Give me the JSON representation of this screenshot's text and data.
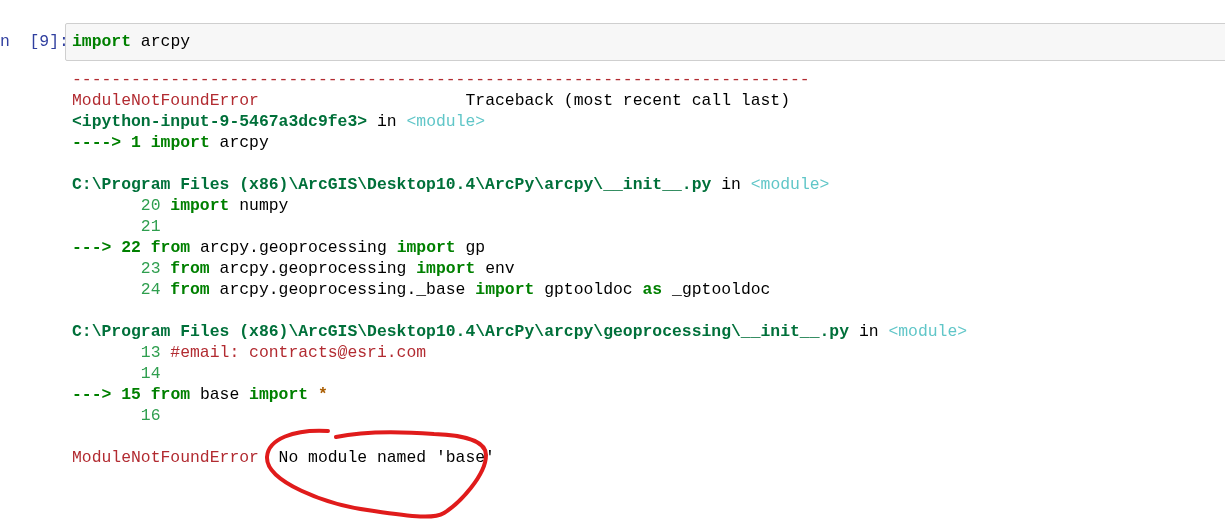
{
  "input_cell": {
    "prompt": "n  [9]:",
    "code": [
      {
        "t": "import",
        "kind": "kw"
      },
      {
        "t": " arcpy",
        "kind": "plain"
      }
    ]
  },
  "output_lines": [
    {
      "kind": "code",
      "tokens": [
        {
          "t": "---------------------------------------------------------------------------",
          "kind": "err"
        }
      ]
    },
    {
      "kind": "code",
      "tokens": [
        {
          "t": "ModuleNotFoundError                     ",
          "kind": "err"
        },
        {
          "t": "Traceback (most recent call last)",
          "kind": "plain"
        }
      ]
    },
    {
      "kind": "code",
      "tokens": [
        {
          "t": "<ipython-input-9-5467a3dc9fe3>",
          "kind": "path"
        },
        {
          "t": " in ",
          "kind": "plain"
        },
        {
          "t": "<module>",
          "kind": "cyan"
        }
      ]
    },
    {
      "kind": "code",
      "tokens": [
        {
          "t": "----> 1 ",
          "kind": "arrow"
        },
        {
          "t": "import",
          "kind": "kw"
        },
        {
          "t": " arcpy",
          "kind": "plain"
        }
      ]
    },
    {
      "kind": "blank"
    },
    {
      "kind": "code",
      "tokens": [
        {
          "t": "C:\\Program Files (x86)\\ArcGIS\\Desktop10.4\\ArcPy\\arcpy\\__init__.py",
          "kind": "path"
        },
        {
          "t": " in ",
          "kind": "plain"
        },
        {
          "t": "<module>",
          "kind": "cyan"
        }
      ]
    },
    {
      "kind": "code",
      "tokens": [
        {
          "t": "20 ",
          "kind": "lineno"
        },
        {
          "t": "import",
          "kind": "kw"
        },
        {
          "t": " numpy",
          "kind": "plain"
        }
      ]
    },
    {
      "kind": "code",
      "tokens": [
        {
          "t": "21",
          "kind": "lineno"
        }
      ]
    },
    {
      "kind": "code",
      "tokens": [
        {
          "t": "---> 22 ",
          "kind": "arrow"
        },
        {
          "t": "from",
          "kind": "kw"
        },
        {
          "t": " arcpy.geoprocessing ",
          "kind": "plain"
        },
        {
          "t": "import",
          "kind": "kw"
        },
        {
          "t": " gp",
          "kind": "plain"
        }
      ]
    },
    {
      "kind": "code",
      "tokens": [
        {
          "t": "23 ",
          "kind": "lineno"
        },
        {
          "t": "from",
          "kind": "kw"
        },
        {
          "t": " arcpy.geoprocessing ",
          "kind": "plain"
        },
        {
          "t": "import",
          "kind": "kw"
        },
        {
          "t": " env",
          "kind": "plain"
        }
      ]
    },
    {
      "kind": "code",
      "tokens": [
        {
          "t": "24 ",
          "kind": "lineno"
        },
        {
          "t": "from",
          "kind": "kw"
        },
        {
          "t": " arcpy.geoprocessing._base ",
          "kind": "plain"
        },
        {
          "t": "import",
          "kind": "kw"
        },
        {
          "t": " gptooldoc ",
          "kind": "plain"
        },
        {
          "t": "as",
          "kind": "kw"
        },
        {
          "t": " _gptooldoc",
          "kind": "plain"
        }
      ]
    },
    {
      "kind": "blank"
    },
    {
      "kind": "code",
      "tokens": [
        {
          "t": "C:\\Program Files (x86)\\ArcGIS\\Desktop10.4\\ArcPy\\arcpy\\geoprocessing\\__init__.py",
          "kind": "path"
        },
        {
          "t": " in ",
          "kind": "plain"
        },
        {
          "t": "<module>",
          "kind": "cyan"
        }
      ]
    },
    {
      "kind": "code",
      "tokens": [
        {
          "t": "13 ",
          "kind": "lineno"
        },
        {
          "t": "#email: contracts@esri.com",
          "kind": "comment"
        }
      ]
    },
    {
      "kind": "code",
      "tokens": [
        {
          "t": "14",
          "kind": "lineno"
        }
      ]
    },
    {
      "kind": "code",
      "tokens": [
        {
          "t": "---> 15 ",
          "kind": "arrow"
        },
        {
          "t": "from",
          "kind": "kw"
        },
        {
          "t": " base ",
          "kind": "plain"
        },
        {
          "t": "import ",
          "kind": "kw"
        },
        {
          "t": "*",
          "kind": "op"
        }
      ]
    },
    {
      "kind": "code",
      "tokens": [
        {
          "t": "16",
          "kind": "lineno"
        }
      ]
    },
    {
      "kind": "blank"
    },
    {
      "kind": "code",
      "tokens": [
        {
          "t": "ModuleNotFoundError",
          "kind": "err"
        },
        {
          "t": "  No module named 'base'",
          "kind": "plain"
        }
      ]
    }
  ],
  "annotations": [
    {
      "kind": "freehand-circle"
    }
  ]
}
